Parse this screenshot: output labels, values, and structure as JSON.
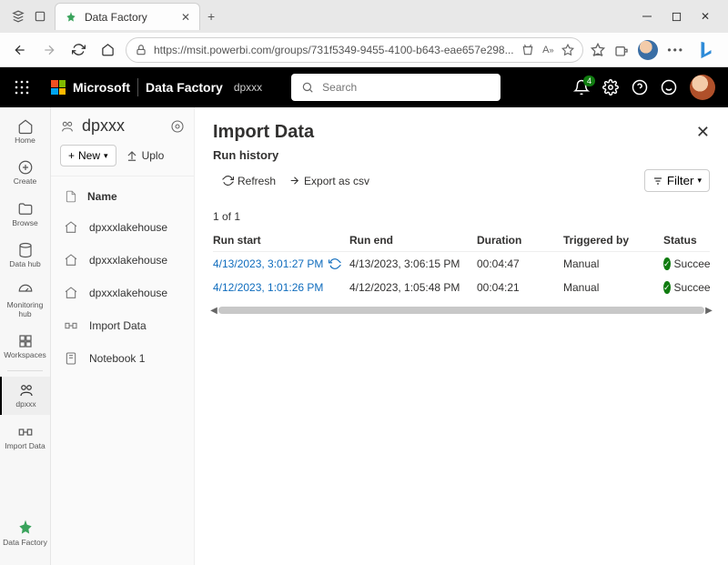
{
  "browser": {
    "tab_title": "Data Factory",
    "url": "https://msit.powerbi.com/groups/731f5349-9455-4100-b643-eae657e298..."
  },
  "appbar": {
    "brand1": "Microsoft",
    "brand2": "Data Factory",
    "scope": "dpxxx",
    "search_placeholder": "Search",
    "notif_count": "4"
  },
  "rail": {
    "items": [
      {
        "label": "Home"
      },
      {
        "label": "Create"
      },
      {
        "label": "Browse"
      },
      {
        "label": "Data hub"
      },
      {
        "label": "Monitoring hub"
      },
      {
        "label": "Workspaces"
      },
      {
        "label": "dpxxx"
      },
      {
        "label": "Import Data"
      }
    ],
    "bottom_label": "Data Factory"
  },
  "workspace": {
    "name": "dpxxx",
    "new_label": "New",
    "upload_label": "Uplo",
    "name_col": "Name",
    "items": [
      {
        "name": "dpxxxlakehouse",
        "icon": "lakehouse"
      },
      {
        "name": "dpxxxlakehouse",
        "icon": "lakehouse"
      },
      {
        "name": "dpxxxlakehouse",
        "icon": "lakehouse"
      },
      {
        "name": "Import Data",
        "icon": "pipeline"
      },
      {
        "name": "Notebook 1",
        "icon": "notebook"
      }
    ]
  },
  "panel": {
    "title": "Import Data",
    "subtitle": "Run history",
    "refresh": "Refresh",
    "export": "Export as csv",
    "filter": "Filter",
    "count": "1 of 1",
    "columns": {
      "run_start": "Run start",
      "run_end": "Run end",
      "duration": "Duration",
      "triggered_by": "Triggered by",
      "status": "Status"
    },
    "rows": [
      {
        "start": "4/13/2023, 3:01:27 PM",
        "end": "4/13/2023, 3:06:15 PM",
        "duration": "00:04:47",
        "trigger": "Manual",
        "status": "Succeede",
        "rerun": true
      },
      {
        "start": "4/12/2023, 1:01:26 PM",
        "end": "4/12/2023, 1:05:48 PM",
        "duration": "00:04:21",
        "trigger": "Manual",
        "status": "Succeede",
        "rerun": false
      }
    ]
  }
}
